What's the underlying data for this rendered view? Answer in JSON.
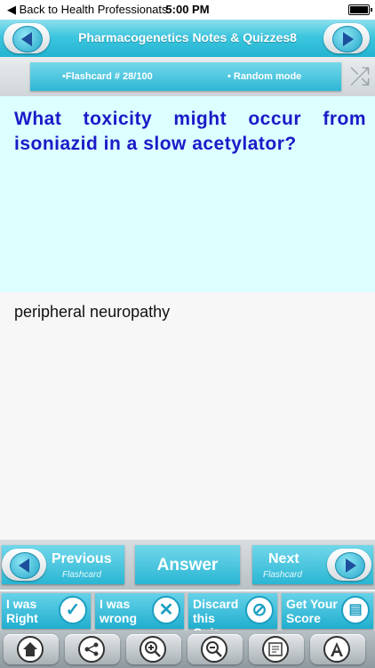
{
  "status_bar": {
    "back_label": "◀ Back to Health Professionats",
    "time": "5:00 PM"
  },
  "header": {
    "title": "Pharmacogenetics Notes & Quizzes8"
  },
  "info_bar": {
    "flashcard": "•Flashcard #  28/100",
    "mode": "• Random mode"
  },
  "question": {
    "text": "What toxicity might occur from isoniazid in a slow acetylator?"
  },
  "answer": {
    "text": "peripheral neuropathy"
  },
  "controls": {
    "previous_label": "Previous",
    "previous_sub": "Flashcard",
    "answer_label": "Answer",
    "next_label": "Next",
    "next_sub": "Flashcard"
  },
  "actions": {
    "right_label": "I was Right",
    "wrong_label": "I was wrong",
    "discard_label": "Discard this Quiz",
    "score_label": "Get Your Score"
  },
  "colors": {
    "accent": "#2ab6d4",
    "question_bg": "#dcffff",
    "question_text": "#1a1ac8"
  }
}
